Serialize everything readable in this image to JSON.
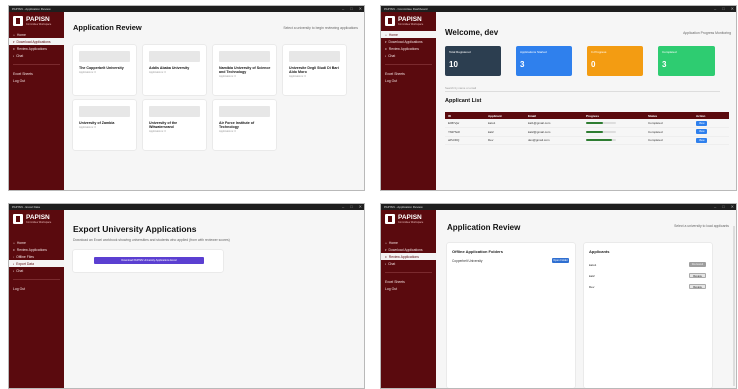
{
  "brand": {
    "name": "PAPISN",
    "sub": "Committee Workspace"
  },
  "w1": {
    "title": "PAPISN - Application Review",
    "heading": "Application Review",
    "hint": "Select a university to begin reviewing applications",
    "nav": [
      "Home",
      "Download Applications",
      "Review Applications",
      "Chat",
      "Excel Sheets",
      "Log Out"
    ],
    "cards": [
      {
        "name": "The Copperbelt University",
        "meta": "Applications: 0"
      },
      {
        "name": "Addis Ababa University",
        "meta": "Applications: 0"
      },
      {
        "name": "Namibia University of Science and Technology",
        "meta": "Applications: 0"
      },
      {
        "name": "Universite Degli Studi Di Bari Aldo Moro",
        "meta": "Applications: 0"
      },
      {
        "name": "University of Zambia",
        "meta": "Applications: 0"
      },
      {
        "name": "University of the Witwatersrand",
        "meta": "Applications: 0"
      },
      {
        "name": "Air Force Institute of Technology",
        "meta": "Applications: 0"
      }
    ]
  },
  "w2": {
    "title": "PAPISN - Committee Dashboard",
    "heading": "Welcome, dev",
    "hint": "Application Progress Monitoring",
    "nav": [
      "Home",
      "Download Applications",
      "Review Applications",
      "Chat",
      "Excel Sheets",
      "Log Out"
    ],
    "stats": [
      {
        "label": "Total Registered",
        "value": "10",
        "color": "#2c3e50"
      },
      {
        "label": "Applications Started",
        "value": "3",
        "color": "#2f80ed"
      },
      {
        "label": "In Progress",
        "value": "0",
        "color": "#f39c12"
      },
      {
        "label": "Completed",
        "value": "3",
        "color": "#2ecc71"
      }
    ],
    "search": "Search by name or email",
    "list_title": "Applicant List",
    "columns": [
      "ID",
      "Applicant",
      "Email",
      "Progress",
      "Status",
      "Action"
    ],
    "rows": [
      {
        "id": "E0fFVjw",
        "name": "kato1",
        "email": "kat1@gmail.com",
        "progress": 0.55,
        "status": "Completed",
        "action": "View"
      },
      {
        "id": "Y6tPTeR",
        "name": "kat2",
        "email": "kat2@gmail.com",
        "progress": 0.55,
        "status": "Completed",
        "action": "View"
      },
      {
        "id": "aPHrDQ",
        "name": "Dev",
        "email": "dev@gmail.com",
        "progress": 0.85,
        "status": "Completed",
        "action": "View"
      }
    ]
  },
  "w3": {
    "title": "PAPISN - Excel Data",
    "heading": "Export University Applications",
    "desc": "Download an Excel workbook showing universities and students who applied (from with reviewer scores)",
    "nav": [
      "Home",
      "Review Applications",
      "Offline Files",
      "Export Data",
      "Chat",
      "Log Out"
    ],
    "button": "Download PAPISN University Applications Excel"
  },
  "w4": {
    "title": "PAPISN - Application Review",
    "heading": "Application Review",
    "hint": "Select a university to load applicants",
    "nav": [
      "Home",
      "Download Applications",
      "Review Applications",
      "Chat",
      "Excel Sheets",
      "Log Out"
    ],
    "folders_title": "Offline Application Folders",
    "folder": "Copperbelt University",
    "open": "Open Folder",
    "applicants_title": "Applicants",
    "applicants": [
      {
        "name": "kato1",
        "btn": "Reviewed"
      },
      {
        "name": "kat2",
        "btn": "Review"
      },
      {
        "name": "Dev",
        "btn": "Review"
      }
    ]
  },
  "icons": {
    "window_controls": [
      "minimize-icon",
      "maximize-icon",
      "close-icon"
    ]
  }
}
